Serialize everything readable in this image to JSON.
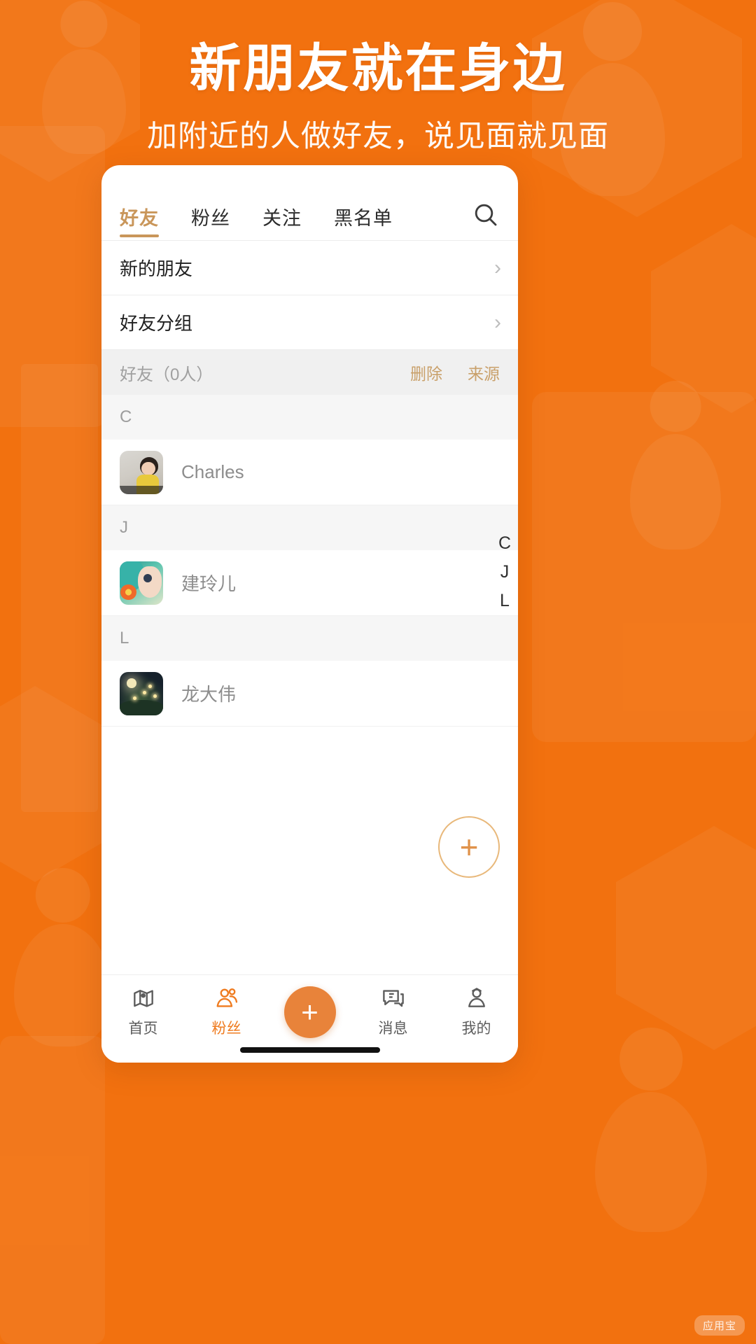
{
  "theme": {
    "brand_orange": "#f2710f",
    "accent_gold": "#c9965a",
    "link_tan": "#c9a06a",
    "nav_active": "#ef7b1f",
    "fab_orange": "#e8833a"
  },
  "promo": {
    "headline": "新朋友就在身边",
    "subheadline": "加附近的人做好友，说见面就见面"
  },
  "tabs": [
    {
      "label": "好友",
      "active": true
    },
    {
      "label": "粉丝",
      "active": false
    },
    {
      "label": "关注",
      "active": false
    },
    {
      "label": "黑名单",
      "active": false
    }
  ],
  "search": {
    "icon": "search-icon"
  },
  "nav_rows": [
    {
      "label": "新的朋友",
      "chevron": "›"
    },
    {
      "label": "好友分组",
      "chevron": "›"
    }
  ],
  "friends_section": {
    "title": "好友（0人）",
    "actions": [
      {
        "label": "删除"
      },
      {
        "label": "来源"
      }
    ]
  },
  "groups": [
    {
      "letter": "C",
      "contacts": [
        {
          "name": "Charles",
          "avatar": "charles-photo"
        }
      ]
    },
    {
      "letter": "J",
      "contacts": [
        {
          "name": "建玲儿",
          "avatar": "jian-photo"
        }
      ]
    },
    {
      "letter": "L",
      "contacts": [
        {
          "name": "龙大伟",
          "avatar": "long-photo"
        }
      ]
    }
  ],
  "alpha_index": [
    "C",
    "J",
    "L"
  ],
  "fab": {
    "label": "+"
  },
  "bottom_nav": {
    "items": [
      {
        "label": "首页",
        "icon": "map-pin-icon",
        "active": false
      },
      {
        "label": "粉丝",
        "icon": "people-icon",
        "active": true
      },
      {
        "label": "消息",
        "icon": "chat-bubble-icon",
        "active": false
      },
      {
        "label": "我的",
        "icon": "user-profile-icon",
        "active": false
      }
    ],
    "center": {
      "label": "+",
      "icon": "plus-icon"
    }
  },
  "watermark": {
    "text": "应用宝"
  }
}
